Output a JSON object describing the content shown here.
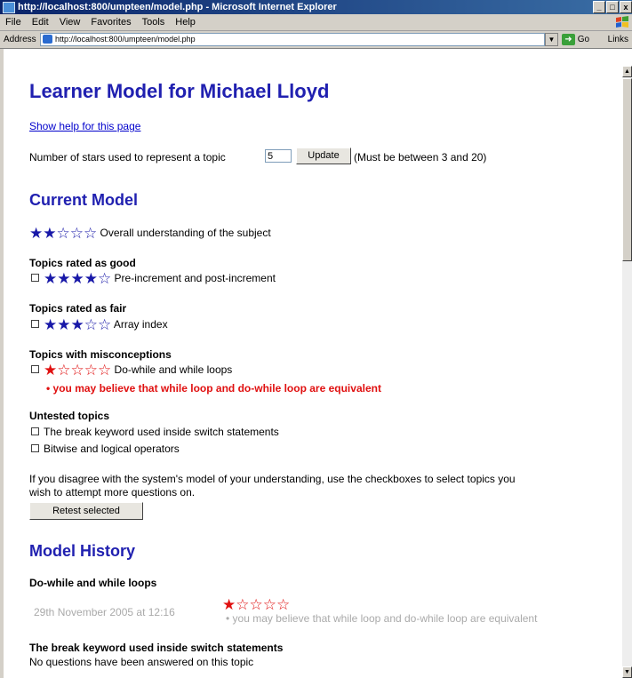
{
  "window": {
    "title": "http://localhost:800/umpteen/model.php - Microsoft Internet Explorer",
    "controls": [
      "_",
      "□",
      "x"
    ]
  },
  "menu": [
    "File",
    "Edit",
    "View",
    "Favorites",
    "Tools",
    "Help"
  ],
  "address_bar": {
    "label": "Address",
    "url": "http://localhost:800/umpteen/model.php",
    "go_label": "Go",
    "links_label": "Links"
  },
  "page": {
    "heading": "Learner Model for Michael Lloyd",
    "help_link": "Show help for this page",
    "stars_prompt": "Number of stars used to represent a topic",
    "stars_value": "5",
    "update_button": "Update",
    "stars_note": "(Must be between 3 and 20)"
  },
  "current_model": {
    "heading": "Current Model",
    "overall": {
      "stars_filled": 2,
      "stars_total": 5,
      "label": "Overall understanding of the subject"
    },
    "groups": {
      "good": {
        "heading": "Topics rated as good",
        "topic": "Pre-increment and post-increment",
        "stars_filled": 4,
        "stars_total": 5
      },
      "fair": {
        "heading": "Topics rated as fair",
        "topic": "Array index",
        "stars_filled": 3,
        "stars_total": 5
      },
      "misconceptions": {
        "heading": "Topics with misconceptions",
        "topic": "Do-while and while loops",
        "stars_filled": 1,
        "stars_total": 5,
        "misconception": "you may believe that while loop and do-while loop are equivalent"
      },
      "untested": {
        "heading": "Untested topics",
        "topics": [
          "The break keyword used inside switch statements",
          "Bitwise and logical operators"
        ]
      }
    },
    "disagree_line1": "If you disagree with the system's model of your understanding, use the checkboxes to select topics you",
    "disagree_line2": "wish to attempt more questions on.",
    "retest_button": "Retest selected"
  },
  "history": {
    "heading": "Model History",
    "entries": [
      {
        "topic": "Do-while and while loops",
        "date": "29th November 2005 at 12:16",
        "stars_filled": 1,
        "stars_total": 5,
        "note": "you may believe that while loop and do-while loop are equivalent"
      },
      {
        "topic": "The break keyword used inside switch statements",
        "note": "No questions have been answered on this topic"
      }
    ]
  },
  "colors": {
    "heading": "#2020b0",
    "star_blue": "#1818a8",
    "star_red": "#e01010",
    "link": "#0000cc"
  }
}
